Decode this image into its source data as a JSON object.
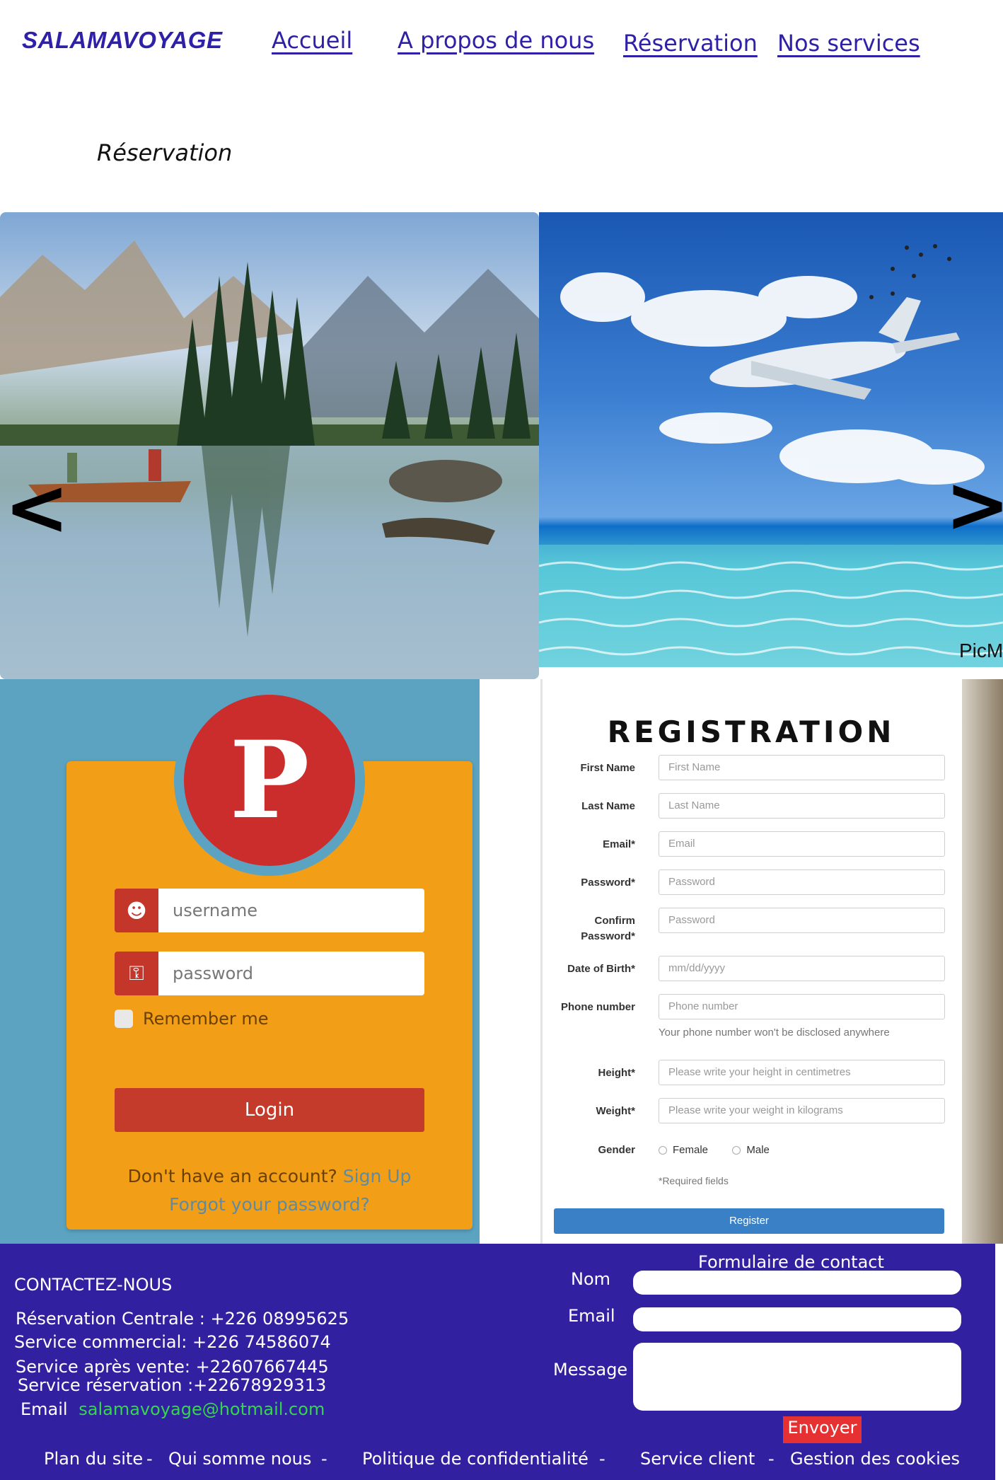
{
  "nav": {
    "brand": "SALAMAVOYAGE",
    "links": [
      "Accueil",
      "A propos de nous",
      "Réservation",
      "Nos services"
    ]
  },
  "page": {
    "title": "Réservation"
  },
  "carousel": {
    "prev": "<",
    "next": ">",
    "watermark": "PicM"
  },
  "login": {
    "username_placeholder": "username",
    "password_placeholder": "password",
    "remember": "Remember me",
    "login_button": "Login",
    "no_account": "Don't have an account?",
    "sign_up": "Sign Up",
    "forgot": "Forgot your password?"
  },
  "registration": {
    "title": "REGISTRATION",
    "fields": [
      {
        "label": "First Name",
        "placeholder": "First Name"
      },
      {
        "label": "Last Name",
        "placeholder": "Last Name"
      },
      {
        "label": "Email*",
        "placeholder": "Email"
      },
      {
        "label": "Password*",
        "placeholder": "Password"
      },
      {
        "label": "Confirm",
        "label2": "Password*",
        "placeholder": "Password"
      },
      {
        "label": "Date of Birth*",
        "placeholder": "mm/dd/yyyy"
      },
      {
        "label": "Phone number",
        "placeholder": "Phone number"
      },
      {
        "label": "Height*",
        "placeholder": "Please write your height in centimetres"
      },
      {
        "label": "Weight*",
        "placeholder": "Please write your weight in kilograms"
      }
    ],
    "phone_help": "Your phone number won't be disclosed anywhere",
    "gender_label": "Gender",
    "gender_options": [
      "Female",
      "Male"
    ],
    "required_note": "*Required fields",
    "register_button": "Register"
  },
  "footer": {
    "contact_heading": "CONTACTEZ-NOUS",
    "lines": [
      "Réservation Centrale : +226 08995625",
      "Service commercial: +226 74586074",
      "Service après vente: +22607667445",
      "Service réservation :+22678929313"
    ],
    "email_label": "Email",
    "email_value": "salamavoyage@hotmail.com",
    "form_title": "Formulaire de contact",
    "nom_label": "Nom",
    "email_field_label": "Email",
    "message_label": "Message",
    "send_button": "Envoyer",
    "links": [
      "Plan du site",
      "Qui somme nous",
      "Politique de confidentialité",
      "Service client",
      "Gestion des cookies"
    ],
    "separator": "-"
  },
  "colors": {
    "brand": "#2e21a8",
    "footer_bg": "#3120a0",
    "email_link": "#35d54e",
    "send_button": "#e53131",
    "login_card": "#f29e17",
    "login_button": "#c43b2c",
    "register_button": "#3a80c6"
  }
}
